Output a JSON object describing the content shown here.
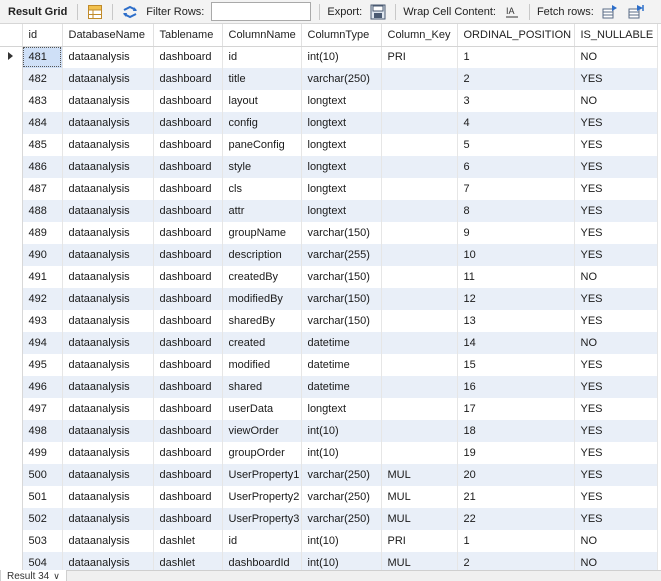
{
  "toolbar": {
    "result_grid_label": "Result Grid",
    "filter_rows_label": "Filter Rows:",
    "filter_rows_value": "",
    "export_label": "Export:",
    "wrap_cell_label": "Wrap Cell Content:",
    "fetch_rows_label": "Fetch rows:"
  },
  "grid": {
    "columns": [
      "id",
      "DatabaseName",
      "Tablename",
      "ColumnName",
      "ColumnType",
      "Column_Key",
      "ORDINAL_POSITION",
      "IS_NULLABLE"
    ],
    "rows": [
      [
        "481",
        "dataanalysis",
        "dashboard",
        "id",
        "int(10)",
        "PRI",
        "1",
        "NO"
      ],
      [
        "482",
        "dataanalysis",
        "dashboard",
        "title",
        "varchar(250)",
        "",
        "2",
        "YES"
      ],
      [
        "483",
        "dataanalysis",
        "dashboard",
        "layout",
        "longtext",
        "",
        "3",
        "NO"
      ],
      [
        "484",
        "dataanalysis",
        "dashboard",
        "config",
        "longtext",
        "",
        "4",
        "YES"
      ],
      [
        "485",
        "dataanalysis",
        "dashboard",
        "paneConfig",
        "longtext",
        "",
        "5",
        "YES"
      ],
      [
        "486",
        "dataanalysis",
        "dashboard",
        "style",
        "longtext",
        "",
        "6",
        "YES"
      ],
      [
        "487",
        "dataanalysis",
        "dashboard",
        "cls",
        "longtext",
        "",
        "7",
        "YES"
      ],
      [
        "488",
        "dataanalysis",
        "dashboard",
        "attr",
        "longtext",
        "",
        "8",
        "YES"
      ],
      [
        "489",
        "dataanalysis",
        "dashboard",
        "groupName",
        "varchar(150)",
        "",
        "9",
        "YES"
      ],
      [
        "490",
        "dataanalysis",
        "dashboard",
        "description",
        "varchar(255)",
        "",
        "10",
        "YES"
      ],
      [
        "491",
        "dataanalysis",
        "dashboard",
        "createdBy",
        "varchar(150)",
        "",
        "11",
        "NO"
      ],
      [
        "492",
        "dataanalysis",
        "dashboard",
        "modifiedBy",
        "varchar(150)",
        "",
        "12",
        "YES"
      ],
      [
        "493",
        "dataanalysis",
        "dashboard",
        "sharedBy",
        "varchar(150)",
        "",
        "13",
        "YES"
      ],
      [
        "494",
        "dataanalysis",
        "dashboard",
        "created",
        "datetime",
        "",
        "14",
        "NO"
      ],
      [
        "495",
        "dataanalysis",
        "dashboard",
        "modified",
        "datetime",
        "",
        "15",
        "YES"
      ],
      [
        "496",
        "dataanalysis",
        "dashboard",
        "shared",
        "datetime",
        "",
        "16",
        "YES"
      ],
      [
        "497",
        "dataanalysis",
        "dashboard",
        "userData",
        "longtext",
        "",
        "17",
        "YES"
      ],
      [
        "498",
        "dataanalysis",
        "dashboard",
        "viewOrder",
        "int(10)",
        "",
        "18",
        "YES"
      ],
      [
        "499",
        "dataanalysis",
        "dashboard",
        "groupOrder",
        "int(10)",
        "",
        "19",
        "YES"
      ],
      [
        "500",
        "dataanalysis",
        "dashboard",
        "UserProperty1",
        "varchar(250)",
        "MUL",
        "20",
        "YES"
      ],
      [
        "501",
        "dataanalysis",
        "dashboard",
        "UserProperty2",
        "varchar(250)",
        "MUL",
        "21",
        "YES"
      ],
      [
        "502",
        "dataanalysis",
        "dashboard",
        "UserProperty3",
        "varchar(250)",
        "MUL",
        "22",
        "YES"
      ],
      [
        "503",
        "dataanalysis",
        "dashlet",
        "id",
        "int(10)",
        "PRI",
        "1",
        "NO"
      ],
      [
        "504",
        "dataanalysis",
        "dashlet",
        "dashboardId",
        "int(10)",
        "MUL",
        "2",
        "NO"
      ]
    ]
  },
  "status": {
    "result_tab_label": "Result 34"
  },
  "icons": {
    "grid": "grid-icon",
    "refresh": "refresh-icon",
    "export": "export-icon",
    "wrap": "wrap-cell-icon",
    "fetch_next": "fetch-next-icon",
    "fetch_all": "fetch-all-icon"
  },
  "colors": {
    "alt_row": "#e9eff8",
    "selected_cell": "#cfe0f7",
    "toolbar_bg": "#f3f3f3"
  }
}
